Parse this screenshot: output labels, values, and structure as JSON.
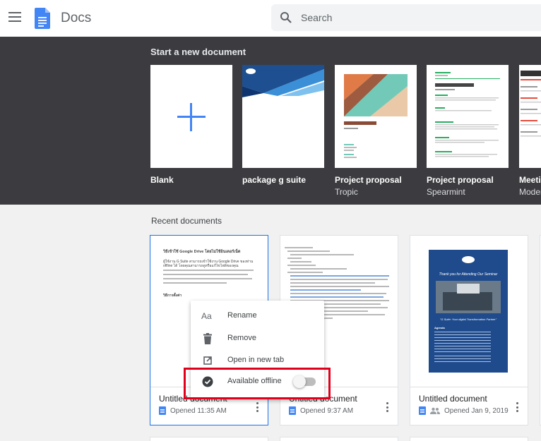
{
  "header": {
    "app_name": "Docs",
    "search_placeholder": "Search"
  },
  "templates": {
    "title": "Start a new document",
    "items": [
      {
        "name": "Blank",
        "subtitle": ""
      },
      {
        "name": "package g suite",
        "subtitle": ""
      },
      {
        "name": "Project proposal",
        "subtitle": "Tropic"
      },
      {
        "name": "Project proposal",
        "subtitle": "Spearmint"
      },
      {
        "name": "Meetin",
        "subtitle": "Moder"
      }
    ]
  },
  "recent": {
    "title": "Recent documents",
    "documents": [
      {
        "title": "Untitled document",
        "meta": "Opened 11:35 AM"
      },
      {
        "title": "Untitled document",
        "meta": "Opened 9:37 AM"
      },
      {
        "title": "Untitled document",
        "meta": "Opened Jan 9, 2019"
      }
    ]
  },
  "thumbnails": {
    "doc1_heading": "วิธีเข้าใช้ Google Drive โดยไม่ใช้อินเตอร์เน็ต",
    "doc1_body": "ผู้ใช้งาน G Suite สามารถเข้าใช้งาน Google Drive ของท่าน offline ได้ โดยคุณสามารถดูหรือแก้ไขไฟล์ของคุณ",
    "doc1_footer": "วิธีการตั้งค่า",
    "doc3_heading": "Thank you for Attending Our Seminar",
    "doc3_subheading": "\"G Suite: Your digital Transformation Partner\"",
    "doc3_agenda": "Agenda"
  },
  "context_menu": {
    "items": [
      {
        "label": "Rename",
        "icon": "rename-icon"
      },
      {
        "label": "Remove",
        "icon": "trash-icon"
      },
      {
        "label": "Open in new tab",
        "icon": "open-new-tab-icon"
      },
      {
        "label": "Available offline",
        "icon": "offline-check-icon",
        "toggle": false
      }
    ]
  },
  "colors": {
    "docs_blue": "#4285f4",
    "templates_bg": "#3c3c40",
    "highlight": "#e0001c",
    "selected_border": "#1a73e8"
  }
}
